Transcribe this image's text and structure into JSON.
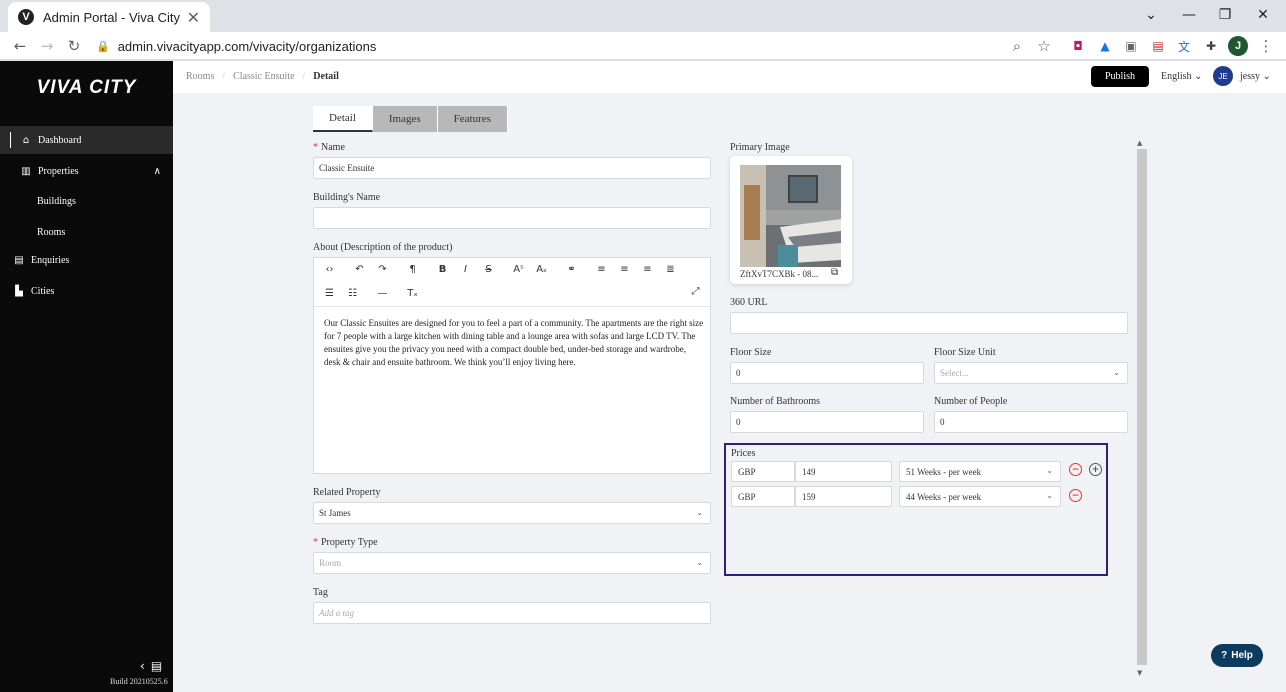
{
  "browser": {
    "tab_title": "Admin Portal - Viva City",
    "favicon": "V",
    "url": "admin.vivacityapp.com/vivacity/organizations",
    "profile_initial": "J"
  },
  "sidebar": {
    "logo": "VIVA CITY",
    "items": [
      {
        "label": "Dashboard",
        "icon": "home-icon"
      },
      {
        "label": "Properties",
        "icon": "building-icon"
      },
      {
        "label": "Buildings"
      },
      {
        "label": "Rooms"
      },
      {
        "label": "Enquiries",
        "icon": "document-icon"
      },
      {
        "label": "Cities",
        "icon": "city-icon"
      }
    ],
    "build": "Build 20210525.6"
  },
  "header": {
    "breadcrumb": [
      "Rooms",
      "Classic Ensuite",
      "Detail"
    ],
    "publish_label": "Publish",
    "language": "English",
    "avatar_initials": "JE",
    "username": "jessy"
  },
  "tabs": [
    "Detail",
    "Images",
    "Features"
  ],
  "form": {
    "name_label": "Name",
    "name_value": "Classic Ensuite",
    "building_label": "Building's Name",
    "building_value": "",
    "about_label": "About (Description of the product)",
    "about_text": "Our Classic Ensuites are designed for you to feel a part of a community. The apartments are the right size for 7 people with a large kitchen with dining table and a lounge area with sofas and large LCD TV. The ensuites give you the privacy you need with a compact double bed, under-bed storage and wardrobe, desk & chair and ensuite bathroom. We think you’ll enjoy living here.",
    "related_label": "Related Property",
    "related_value": "St James",
    "type_label": "Property Type",
    "type_placeholder": "Room",
    "tag_label": "Tag",
    "tag_placeholder": "Add a tag",
    "primary_image_label": "Primary Image",
    "primary_image_name": "ZftXvT7CXBk - 08...",
    "url360_label": "360 URL",
    "url360_value": "",
    "floor_size_label": "Floor Size",
    "floor_size_value": "0",
    "floor_unit_label": "Floor Size Unit",
    "floor_unit_placeholder": "Select...",
    "bathrooms_label": "Number of Bathrooms",
    "bathrooms_value": "0",
    "people_label": "Number of People",
    "people_value": "0",
    "prices_label": "Prices",
    "prices": [
      {
        "currency": "GBP",
        "amount": "149",
        "period": "51 Weeks - per week"
      },
      {
        "currency": "GBP",
        "amount": "159",
        "period": "44 Weeks - per week"
      }
    ]
  },
  "help_label": "Help"
}
